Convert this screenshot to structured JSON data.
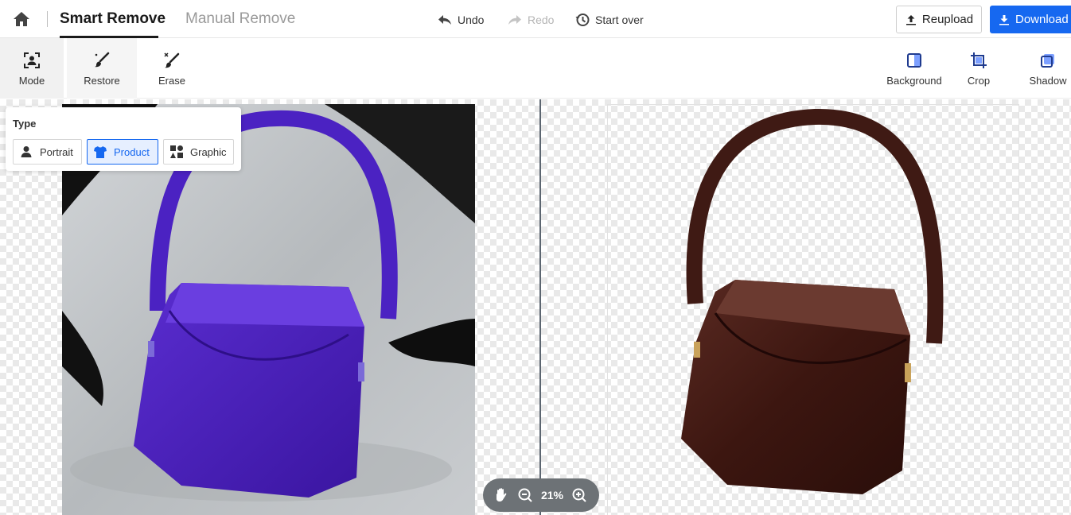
{
  "header": {
    "tabs": [
      "Smart Remove",
      "Manual Remove"
    ],
    "undo": "Undo",
    "redo": "Redo",
    "start_over": "Start over",
    "reupload": "Reupload",
    "download": "Download"
  },
  "toolbar": {
    "left": [
      "Mode",
      "Restore",
      "Erase"
    ],
    "right": [
      "Background",
      "Crop",
      "Shadow"
    ]
  },
  "type_panel": {
    "title": "Type",
    "options": [
      "Portrait",
      "Product",
      "Graphic"
    ],
    "selected": "Product"
  },
  "zoom": {
    "value": "21%"
  },
  "colors": {
    "accent": "#1668f0",
    "bag_original": "#4b1fb0",
    "bag_result": "#4a1c16"
  },
  "icons": [
    "home-icon",
    "undo-icon",
    "redo-icon",
    "history-icon",
    "upload-icon",
    "download-icon",
    "mode-icon",
    "restore-icon",
    "erase-icon",
    "background-icon",
    "crop-icon",
    "shadow-icon",
    "portrait-icon",
    "shirt-icon",
    "shapes-icon",
    "hand-icon",
    "zoom-out-icon",
    "zoom-in-icon"
  ]
}
